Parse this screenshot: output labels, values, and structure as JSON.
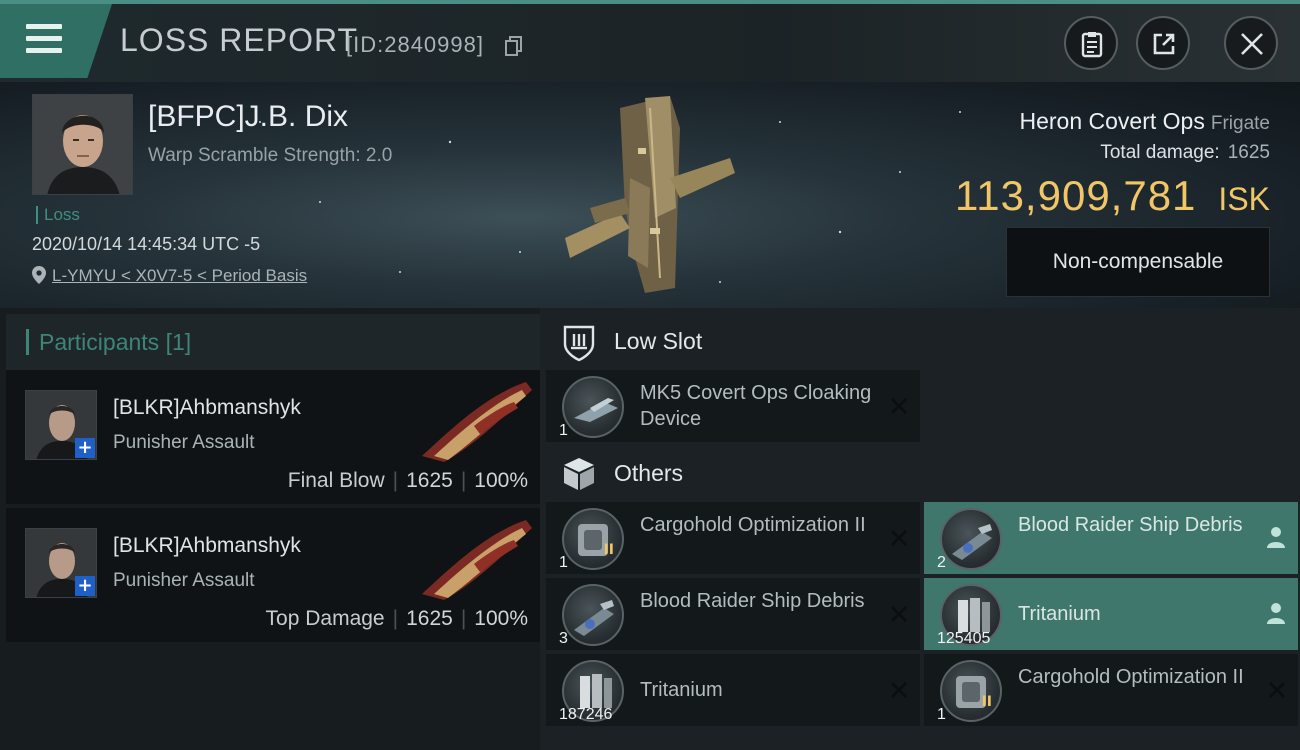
{
  "header": {
    "title": "LOSS REPORT",
    "report_id": "[ID:2840998]",
    "icons": {
      "menu": "hamburger-menu-icon",
      "copy": "copy-icon",
      "clipboard": "clipboard-icon",
      "share": "share-icon",
      "close": "close-icon"
    }
  },
  "victim": {
    "pilot_name": "[BFPC]J.B. Dix",
    "warp_scramble": "Warp Scramble Strength: 2.0",
    "loss_label": "Loss",
    "timestamp": "2020/10/14 14:45:34 UTC -5",
    "location": "L-YMYU < X0V7-5 < Period Basis",
    "ship_name": "Heron Covert Ops",
    "ship_class": "Frigate",
    "total_damage_label": "Total damage:",
    "total_damage": "1625",
    "isk_value": "113,909,781",
    "isk_unit": "ISK",
    "status": "Non-compensable"
  },
  "participants": {
    "label": "Participants",
    "count": "[1]",
    "rows": [
      {
        "name": "[BLKR]Ahbmanshyk",
        "ship": "Punisher Assault",
        "role": "Final Blow",
        "damage": "1625",
        "percent": "100%"
      },
      {
        "name": "[BLKR]Ahbmanshyk",
        "ship": "Punisher Assault",
        "role": "Top Damage",
        "damage": "1625",
        "percent": "100%"
      }
    ]
  },
  "sections": {
    "low_slot": "Low Slot",
    "others": "Others"
  },
  "items": {
    "low_slot": [
      {
        "name": "MK5 Covert Ops Cloaking Device",
        "qty": "1",
        "status": "destroyed"
      }
    ],
    "others": [
      {
        "name": "Cargohold Optimization II",
        "qty": "1",
        "status": "destroyed"
      },
      {
        "name": "Blood Raider Ship Debris",
        "qty": "2",
        "status": "dropped"
      },
      {
        "name": "Blood Raider Ship Debris",
        "qty": "3",
        "status": "destroyed"
      },
      {
        "name": "Tritanium",
        "qty": "125405",
        "status": "dropped"
      },
      {
        "name": "Tritanium",
        "qty": "187246",
        "status": "destroyed"
      },
      {
        "name": "Cargohold Optimization II",
        "qty": "1",
        "status": "destroyed"
      }
    ]
  },
  "colors": {
    "accent": "#3f776d",
    "isk": "#f0c667",
    "teal_text": "#3d8577"
  }
}
